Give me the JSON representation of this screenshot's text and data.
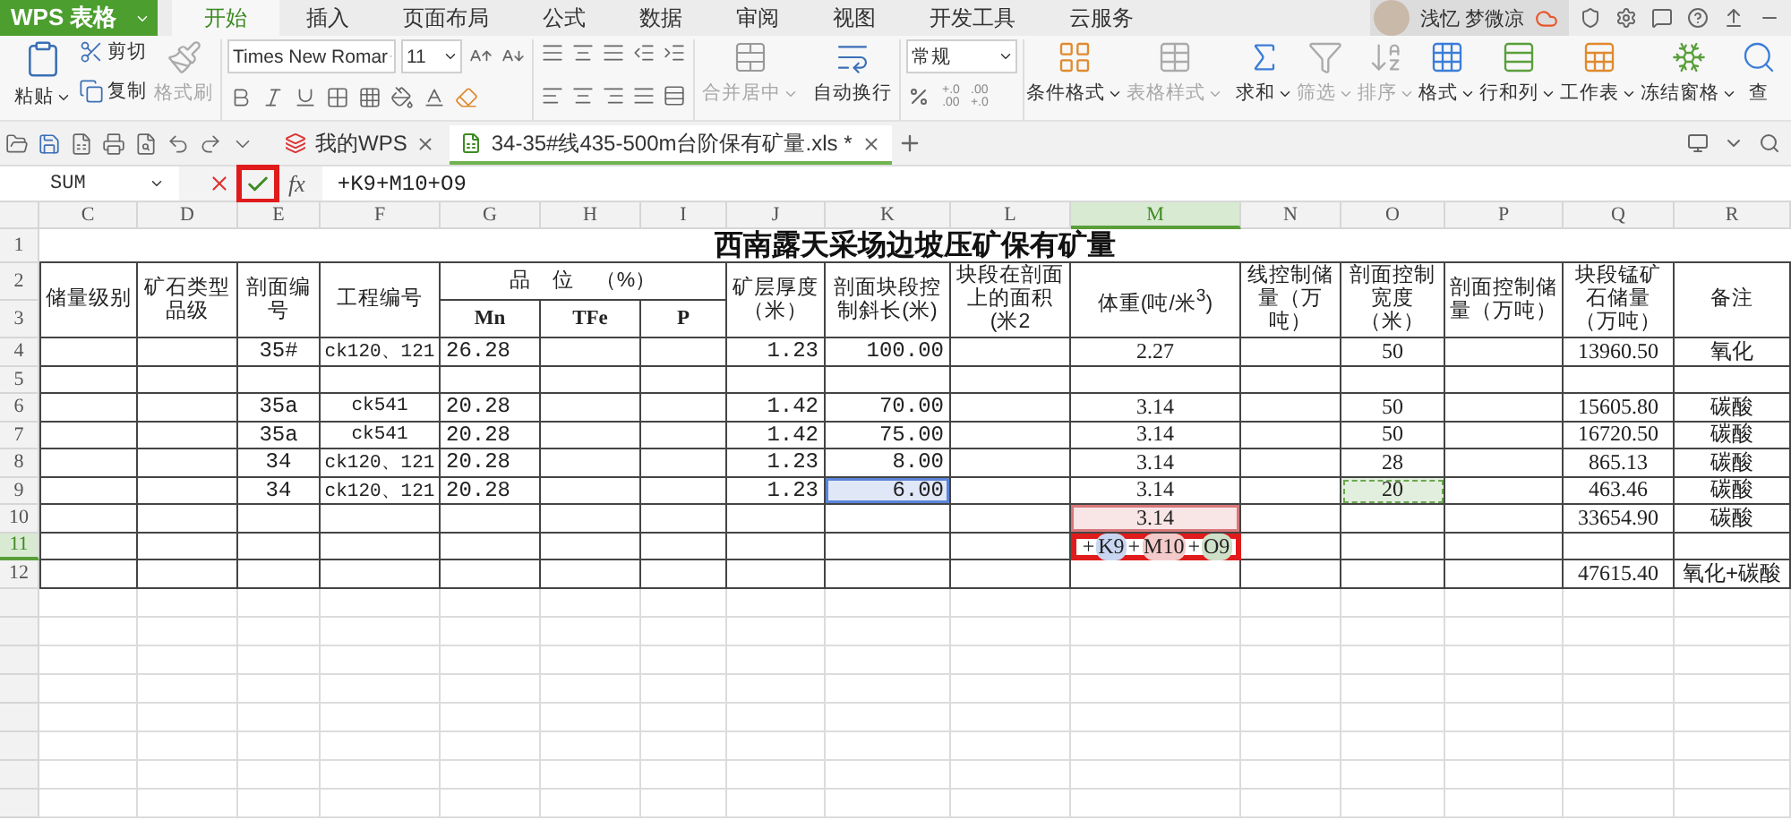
{
  "app_button": {
    "label": "WPS 表格"
  },
  "ribbon_tabs": [
    {
      "label": "开始",
      "selected": true
    },
    {
      "label": "插入",
      "selected": false
    },
    {
      "label": "页面布局",
      "selected": false
    },
    {
      "label": "公式",
      "selected": false
    },
    {
      "label": "数据",
      "selected": false
    },
    {
      "label": "审阅",
      "selected": false
    },
    {
      "label": "视图",
      "selected": false
    },
    {
      "label": "开发工具",
      "selected": false
    },
    {
      "label": "云服务",
      "selected": false
    }
  ],
  "user": {
    "name": "浅忆 梦微凉"
  },
  "ribbon": {
    "clipboard": [
      {
        "label": "粘贴",
        "disabled": false
      },
      {
        "label": "剪切",
        "disabled": false
      },
      {
        "label": "复制",
        "disabled": false
      },
      {
        "label": "格式刷",
        "disabled": true
      }
    ],
    "font": {
      "family": "Times New Romar",
      "size": "11"
    },
    "alignment_buttons": [
      {
        "label": "合并居中",
        "disabled": true
      },
      {
        "label": "自动换行",
        "disabled": false
      }
    ],
    "number_format": "常规",
    "decimal_buttons": [
      {
        "top": "+.0",
        "bottom": ".00"
      },
      {
        "top": ".00",
        "bottom": "+.0"
      }
    ],
    "tools": [
      {
        "label": "条件格式",
        "disabled": false
      },
      {
        "label": "表格样式",
        "disabled": true
      },
      {
        "label": "求和",
        "disabled": false
      },
      {
        "label": "筛选",
        "disabled": true
      },
      {
        "label": "排序",
        "disabled": true
      },
      {
        "label": "格式",
        "disabled": false
      },
      {
        "label": "行和列",
        "disabled": false
      },
      {
        "label": "工作表",
        "disabled": false
      },
      {
        "label": "冻结窗格",
        "disabled": false
      },
      {
        "label": "查",
        "disabled": false
      }
    ]
  },
  "document_tabs": [
    {
      "label": "我的WPS",
      "selected": false
    },
    {
      "label": "34-35#线435-500m台阶保有矿量.xls *",
      "selected": true
    }
  ],
  "formula_bar": {
    "name_box": "SUM",
    "fx": "fx",
    "formula": "+K9+M10+O9",
    "confirm_flagged": true
  },
  "sheet": {
    "columns": [
      {
        "label": "C",
        "selected": false
      },
      {
        "label": "D",
        "selected": false
      },
      {
        "label": "E",
        "selected": false
      },
      {
        "label": "F",
        "selected": false
      },
      {
        "label": "G",
        "selected": false
      },
      {
        "label": "H",
        "selected": false
      },
      {
        "label": "I",
        "selected": false
      },
      {
        "label": "J",
        "selected": false
      },
      {
        "label": "K",
        "selected": false
      },
      {
        "label": "L",
        "selected": false
      },
      {
        "label": "M",
        "selected": true
      },
      {
        "label": "N",
        "selected": false
      },
      {
        "label": "O",
        "selected": false
      },
      {
        "label": "P",
        "selected": false
      },
      {
        "label": "Q",
        "selected": false
      },
      {
        "label": "R",
        "selected": false
      }
    ],
    "rows": [
      {
        "label": "1",
        "selected": false
      },
      {
        "label": "2",
        "selected": false
      },
      {
        "label": "3",
        "selected": false
      },
      {
        "label": "4",
        "selected": false
      },
      {
        "label": "5",
        "selected": false
      },
      {
        "label": "6",
        "selected": false
      },
      {
        "label": "7",
        "selected": false
      },
      {
        "label": "8",
        "selected": false
      },
      {
        "label": "9",
        "selected": false
      },
      {
        "label": "10",
        "selected": false
      },
      {
        "label": "11",
        "selected": true
      },
      {
        "label": "12",
        "selected": false
      }
    ],
    "title": "西南露天采场边坡压矿保有矿量",
    "header_cells": [
      {
        "kind": "tall",
        "text": "储量级别"
      },
      {
        "kind": "tall",
        "text": "矿石类型品级"
      },
      {
        "kind": "tall",
        "text": "剖面编号"
      },
      {
        "kind": "tall",
        "text": "工程编号"
      },
      {
        "kind": "group",
        "text": "品　位　（%）",
        "children": [
          {
            "text": "Mn"
          },
          {
            "text": "TFe"
          },
          {
            "text": "P"
          }
        ]
      },
      {
        "kind": "tall",
        "text": "矿层厚度（米）"
      },
      {
        "kind": "tall",
        "text": "剖面块段控制斜长(米)"
      },
      {
        "kind": "tall",
        "text": "块段在剖面上的面积(米2"
      },
      {
        "kind": "tall",
        "text": "体重(吨/米$^{3}$)"
      },
      {
        "kind": "tall",
        "text": "线控制储量（万吨）"
      },
      {
        "kind": "tall",
        "text": "剖面控制宽度（米）"
      },
      {
        "kind": "tall",
        "text": "剖面控制储量（万吨）"
      },
      {
        "kind": "tall",
        "text": "块段锰矿石储量（万吨）"
      },
      {
        "kind": "tall",
        "text": "备注"
      }
    ],
    "data_rows": [
      {
        "cells": [
          null,
          null,
          "35#",
          "ck120、121",
          "26.28",
          null,
          null,
          "1.23",
          "100.00",
          null,
          "2.27",
          null,
          "50",
          null,
          "13960.50",
          "氧化"
        ]
      },
      {
        "cells": [
          null,
          null,
          null,
          null,
          null,
          null,
          null,
          null,
          null,
          null,
          null,
          null,
          null,
          null,
          null,
          null
        ]
      },
      {
        "cells": [
          null,
          null,
          "35a",
          "ck541",
          "20.28",
          null,
          null,
          "1.42",
          "70.00",
          null,
          "3.14",
          null,
          "50",
          null,
          "15605.80",
          "碳酸"
        ]
      },
      {
        "cells": [
          null,
          null,
          "35a",
          "ck541",
          "20.28",
          null,
          null,
          "1.42",
          "75.00",
          null,
          "3.14",
          null,
          "50",
          null,
          "16720.50",
          "碳酸"
        ]
      },
      {
        "cells": [
          null,
          null,
          "34",
          "ck120、121",
          "20.28",
          null,
          null,
          "1.23",
          "8.00",
          null,
          "3.14",
          null,
          "28",
          null,
          "865.13",
          "碳酸"
        ]
      },
      {
        "cells": [
          null,
          null,
          "34",
          "ck120、121",
          "20.28",
          null,
          null,
          "1.23",
          {
            "text": "6.00",
            "color": "#5b85d9",
            "dashed": false
          },
          null,
          "3.14",
          null,
          {
            "text": "20",
            "color": "#6aa84f",
            "dashed": true
          },
          null,
          "463.46",
          "碳酸"
        ]
      },
      {
        "cells": [
          null,
          null,
          null,
          null,
          null,
          null,
          null,
          null,
          null,
          null,
          {
            "text": "3.14",
            "color": "#d9777a",
            "dashed": false
          },
          null,
          null,
          null,
          "33654.90",
          "碳酸"
        ]
      },
      {
        "cells": [
          null,
          null,
          null,
          null,
          null,
          null,
          null,
          null,
          null,
          null,
          {
            "kind": "editing",
            "flagged": true,
            "tokens": [
              {
                "text": "+"
              },
              {
                "text": "K9",
                "color": "#c9d6f2"
              },
              {
                "text": "+"
              },
              {
                "text": "M10",
                "color": "#f3caca"
              },
              {
                "text": "+"
              },
              {
                "text": "O9",
                "color": "#cfe0c8"
              }
            ]
          },
          null,
          null,
          null,
          null,
          null
        ]
      },
      {
        "cells": [
          null,
          null,
          null,
          null,
          null,
          null,
          null,
          null,
          null,
          null,
          null,
          null,
          null,
          null,
          "47615.40",
          "氧化+碳酸"
        ]
      }
    ]
  }
}
